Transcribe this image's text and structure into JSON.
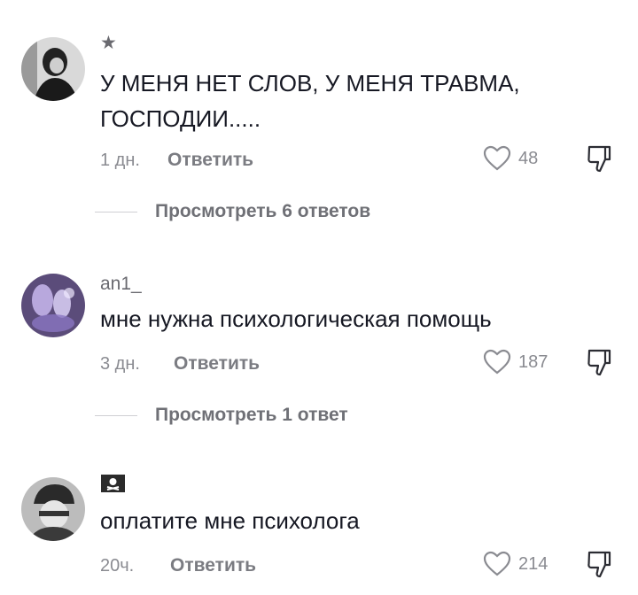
{
  "comments": [
    {
      "username": "★",
      "text_lines": [
        "У МЕНЯ НЕТ СЛОВ, У МЕНЯ ТРАВМА,",
        "ГОСПОДИИ....."
      ],
      "time": "1 дн.",
      "reply_label": "Ответить",
      "likes": "48",
      "view_replies": "Просмотреть 6 ответов",
      "avatar_icon": "avatar-person-dark-icon"
    },
    {
      "username": "an1_",
      "text_lines": [
        "мне нужна психологическая помощь"
      ],
      "time": "3 дн.",
      "reply_label": "Ответить",
      "likes": "187",
      "view_replies": "Просмотреть 1 ответ",
      "avatar_icon": "avatar-purple-glow-icon"
    },
    {
      "username": "🏴‍☠️",
      "text_lines": [
        "оплатите мне психолога"
      ],
      "time": "20ч.",
      "reply_label": "Ответить",
      "likes": "214",
      "avatar_icon": "avatar-person-beanie-icon"
    }
  ],
  "colors": {
    "text": "#161823",
    "secondary": "#8a8b91",
    "divider": "#cfcfd3"
  }
}
